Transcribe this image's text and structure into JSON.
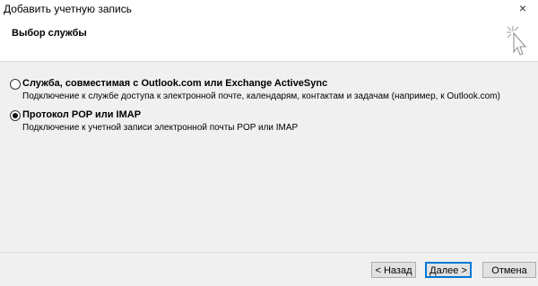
{
  "window": {
    "title": "Добавить учетную запись",
    "close_glyph": "×"
  },
  "header": {
    "title": "Выбор службы",
    "icon": "wizard-wand-icon"
  },
  "options": [
    {
      "label": "Служба, совместимая с Outlook.com или Exchange ActiveSync",
      "description": "Подключение к службе доступа к электронной почте, календарям, контактам и задачам (например, к Outlook.com)",
      "checked": false
    },
    {
      "label": "Протокол POP или IMAP",
      "description": "Подключение к учетной записи электронной почты POP или IMAP",
      "checked": true
    }
  ],
  "footer": {
    "back_label": "< Назад",
    "next_label": "Далее >",
    "cancel_label": "Отмена"
  },
  "colors": {
    "accent": "#0078d7",
    "content_bg": "#f0f0f0"
  }
}
